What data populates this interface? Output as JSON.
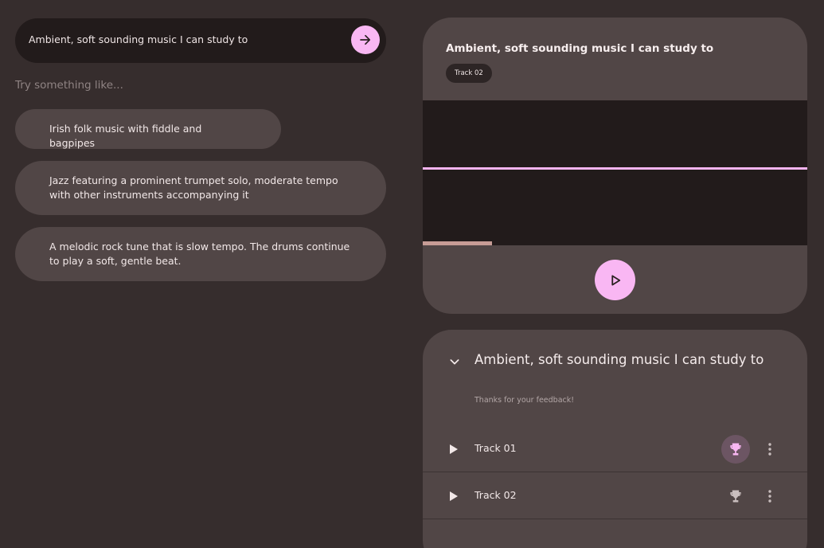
{
  "colors": {
    "background": "#362d2d",
    "surface": "#514646",
    "dark_surface": "#221b1b",
    "accent": "#f9b7f3",
    "wave": "#f7b4f0",
    "trophy_muted": "#c9bebe",
    "trophy_active": "#f9b7f3"
  },
  "prompt": {
    "text": "Ambient, soft sounding music I can study to",
    "send_icon": "arrow-right-icon"
  },
  "suggestions": {
    "heading": "Try something like...",
    "items": [
      {
        "label": "Irish folk music with fiddle and bagpipes"
      },
      {
        "label": "Jazz featuring a prominent trumpet solo, moderate tempo with other instruments accompanying it"
      },
      {
        "label": "A melodic rock tune that is slow tempo. The drums continue to play a soft, gentle beat."
      }
    ]
  },
  "player": {
    "title": "Ambient, soft sounding music I can study to",
    "track_chip": "Track 02",
    "progress_fraction": 0.18,
    "play_icon": "play-icon"
  },
  "results": {
    "title": "Ambient, soft sounding music I can study to",
    "feedback": "Thanks for your feedback!",
    "tracks": [
      {
        "name": "Track 01",
        "trophy_active": true
      },
      {
        "name": "Track 02",
        "trophy_active": false
      }
    ]
  }
}
